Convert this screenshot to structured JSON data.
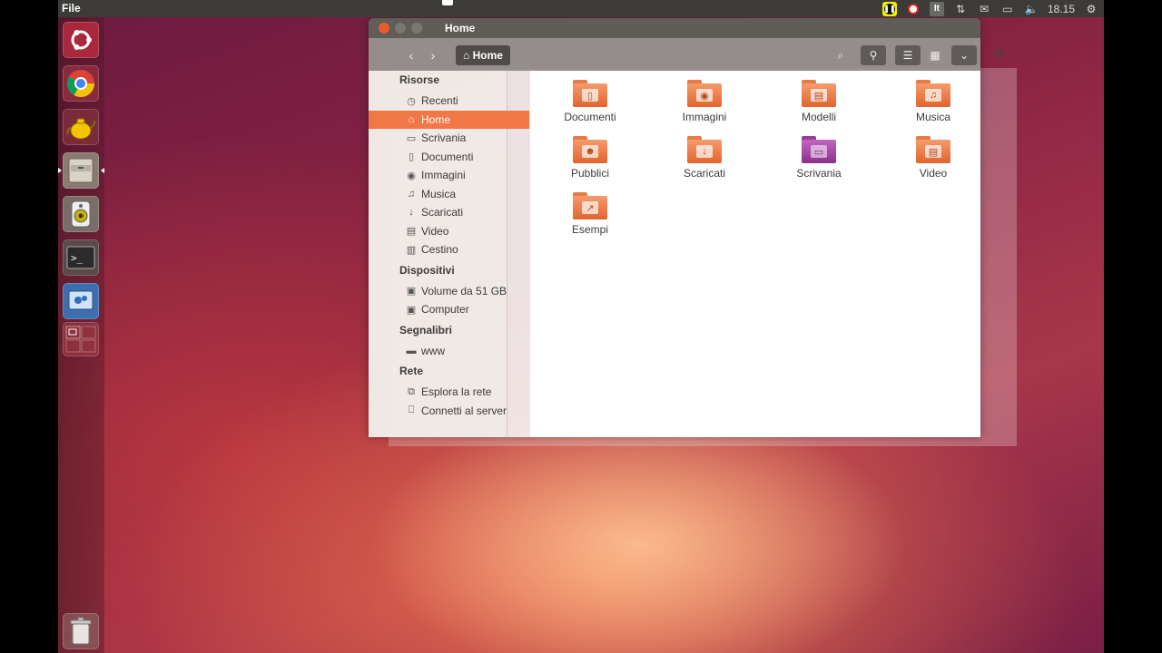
{
  "panel": {
    "app_menu": "File",
    "clock": "18.15",
    "indicators": [
      "pause-recording",
      "stop-recording",
      "keyboard",
      "network",
      "mail",
      "battery",
      "volume",
      "settings"
    ],
    "keyboard_label": "It"
  },
  "launcher": {
    "items": [
      "ubuntu-dash",
      "chrome",
      "teapot-app",
      "files",
      "speaker-app",
      "terminal",
      "ubuntu-one",
      "workspace-switcher",
      "trash"
    ]
  },
  "window": {
    "title": "Home",
    "path_button": "Home",
    "sidebar": {
      "groups": [
        {
          "title": "Risorse",
          "items": [
            {
              "label": "Recenti",
              "icon": "clock-icon"
            },
            {
              "label": "Home",
              "icon": "home-icon",
              "active": true
            },
            {
              "label": "Scrivania",
              "icon": "desktop-icon"
            },
            {
              "label": "Documenti",
              "icon": "document-icon"
            },
            {
              "label": "Immagini",
              "icon": "camera-icon"
            },
            {
              "label": "Musica",
              "icon": "music-icon"
            },
            {
              "label": "Scaricati",
              "icon": "download-icon"
            },
            {
              "label": "Video",
              "icon": "film-icon"
            },
            {
              "label": "Cestino",
              "icon": "trash-icon"
            }
          ]
        },
        {
          "title": "Dispositivi",
          "items": [
            {
              "label": "Volume da 51 GB",
              "icon": "drive-icon"
            },
            {
              "label": "Computer",
              "icon": "drive-icon"
            }
          ]
        },
        {
          "title": "Segnalibri",
          "items": [
            {
              "label": "www",
              "icon": "folder-icon"
            }
          ]
        },
        {
          "title": "Rete",
          "items": [
            {
              "label": "Esplora la rete",
              "icon": "network-icon"
            },
            {
              "label": "Connetti al server",
              "icon": "server-icon"
            }
          ]
        }
      ]
    },
    "files": [
      {
        "label": "Documenti",
        "icon": "document-icon",
        "style": "orange"
      },
      {
        "label": "Immagini",
        "icon": "camera-icon",
        "style": "orange"
      },
      {
        "label": "Modelli",
        "icon": "template-icon",
        "style": "orange"
      },
      {
        "label": "Musica",
        "icon": "music-icon",
        "style": "orange"
      },
      {
        "label": "Pubblici",
        "icon": "person-icon",
        "style": "orange"
      },
      {
        "label": "Scaricati",
        "icon": "download-icon",
        "style": "orange"
      },
      {
        "label": "Scrivania",
        "icon": "desktop-icon",
        "style": "purple"
      },
      {
        "label": "Video",
        "icon": "film-icon",
        "style": "orange"
      },
      {
        "label": "Esempi",
        "icon": "link-icon",
        "style": "orange"
      }
    ]
  },
  "colors": {
    "accent": "#f07746",
    "panel": "#3c3b37",
    "folder_orange": "#e87a45",
    "folder_purple": "#9a3e9a"
  }
}
